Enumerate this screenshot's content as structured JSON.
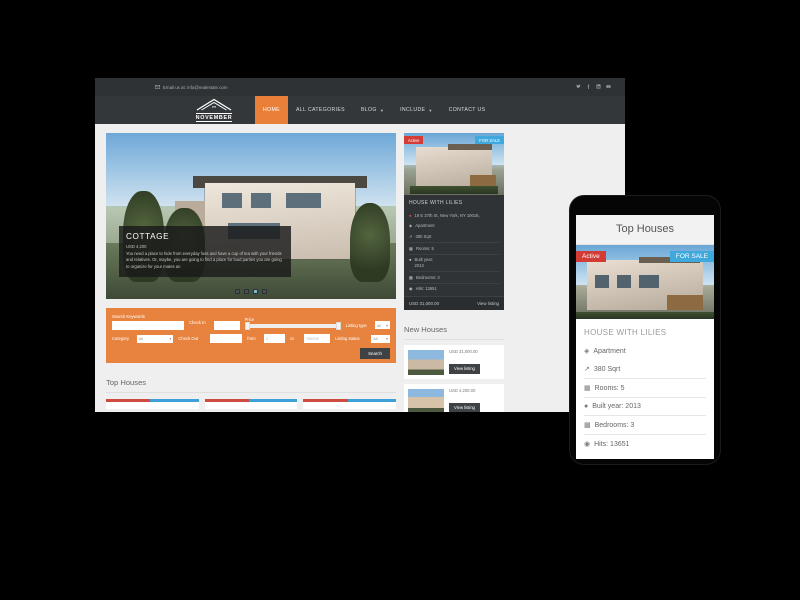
{
  "site": {
    "topbar": {
      "email_icon": "envelope-icon",
      "email_text": "Email us at: info@realestate.com",
      "socials": [
        {
          "name": "twitter-icon",
          "glyph": "ᴠ"
        },
        {
          "name": "facebook-icon",
          "glyph": "f"
        },
        {
          "name": "linkedin-icon",
          "glyph": "in"
        },
        {
          "name": "youtube-icon",
          "glyph": "▶"
        }
      ]
    },
    "logo": {
      "brand": "NOVEMBER",
      "icon": "house-roof-logo-icon"
    },
    "nav": [
      {
        "label": "HOME",
        "active": true,
        "dropdown": false
      },
      {
        "label": "ALL CATEGORIES",
        "active": false,
        "dropdown": false
      },
      {
        "label": "BLOG",
        "active": false,
        "dropdown": true
      },
      {
        "label": "INCLUDE",
        "active": false,
        "dropdown": true
      },
      {
        "label": "CONTACT US",
        "active": false,
        "dropdown": false
      }
    ],
    "accent_color": "#e8833f",
    "dark_color": "#33373a",
    "active_badge_color": "#d23c35",
    "sale_badge_color": "#3fa8dd"
  },
  "hero": {
    "title": "COTTAGE",
    "price": "USD 4,200",
    "description": "You need a place to hide from everyday fuss and have a cup of tea with your friends and relatives. Or, maybe, you are going to find a place for loud parties you are going to organize for your mates an",
    "dots": [
      false,
      false,
      true,
      false
    ]
  },
  "search": {
    "keywords_label": "Search Keywords",
    "keywords_value": "",
    "category_label": "Category",
    "category_value": "All",
    "checkin_label": "Check In",
    "checkin_value": "",
    "checkout_label": "Check Out",
    "checkout_value": "",
    "price_label": "Price",
    "from_label": "from",
    "from_value": "0",
    "to_label": "to",
    "to_value": "750000",
    "listing_type_label": "Listing type",
    "listing_type_value": "All",
    "listing_status_label": "Listing status",
    "listing_status_value": "All",
    "submit_label": "Search"
  },
  "top_houses": {
    "title": "Top Houses"
  },
  "featured": {
    "badge_active": "Active",
    "badge_sale": "FOR SALE",
    "title": "HOUSE WITH LILIES",
    "address": "19 E 37th St, New York, NY 10016,",
    "type": "Apartment",
    "area": "380 Sqrt",
    "rooms": "Rooms: 5",
    "built_label": "Built year:",
    "built_value": "2013",
    "bedrooms": "Bedrooms: 3",
    "hits": "Hits: 13651",
    "price": "USD 31,000.00",
    "view_label": "View listing",
    "icons": {
      "address": "map-pin-icon",
      "type": "tag-icon",
      "area": "resize-arrow-icon",
      "rooms": "building-icon",
      "built": "droplet-icon",
      "bedrooms": "bed-icon",
      "hits": "eye-icon"
    }
  },
  "new_houses": {
    "title": "New Houses",
    "items": [
      {
        "price": "USD 31,000.00",
        "button": "View listing"
      },
      {
        "price": "USD 4,200.00",
        "button": "View listing"
      }
    ]
  },
  "mobile": {
    "title": "Top Houses",
    "badge_active": "Active",
    "badge_sale": "FOR SALE",
    "name": "HOUSE WITH LILIES",
    "type": "Apartment",
    "area": "380 Sqrt",
    "rooms": "Rooms: 5",
    "built": "Built year: 2013",
    "bedrooms": "Bedrooms: 3",
    "hits": "Hits: 13651"
  }
}
